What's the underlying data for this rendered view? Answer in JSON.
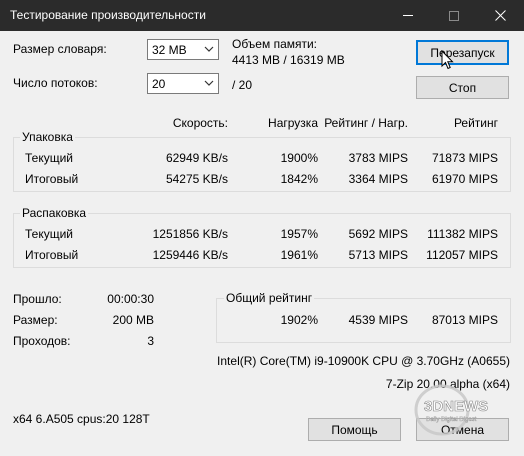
{
  "window": {
    "title": "Тестирование производительности"
  },
  "top": {
    "dict_label": "Размер словаря:",
    "dict_value": "32 MB",
    "threads_label": "Число потоков:",
    "threads_value": "20",
    "threads_max": "/ 20",
    "memory_label": "Объем памяти:",
    "memory_value": "4413 MB / 16319 MB",
    "restart_button": "Перезапуск",
    "stop_button": "Стоп"
  },
  "headers": {
    "speed": "Скорость:",
    "load": "Нагрузка",
    "rating_load": "Рейтинг / Нагр.",
    "rating": "Рейтинг"
  },
  "packing": {
    "title": "Упаковка",
    "rows": [
      {
        "name": "Текущий",
        "speed": "62949 KB/s",
        "load": "1900%",
        "rating_load": "3783 MIPS",
        "rating": "71873 MIPS"
      },
      {
        "name": "Итоговый",
        "speed": "54275 KB/s",
        "load": "1842%",
        "rating_load": "3364 MIPS",
        "rating": "61970 MIPS"
      }
    ]
  },
  "unpacking": {
    "title": "Распаковка",
    "rows": [
      {
        "name": "Текущий",
        "speed": "1251856 KB/s",
        "load": "1957%",
        "rating_load": "5692 MIPS",
        "rating": "111382 MIPS"
      },
      {
        "name": "Итоговый",
        "speed": "1259446 KB/s",
        "load": "1961%",
        "rating_load": "5713 MIPS",
        "rating": "112057 MIPS"
      }
    ]
  },
  "stats": {
    "elapsed_label": "Прошло:",
    "elapsed_value": "00:00:30",
    "size_label": "Размер:",
    "size_value": "200 MB",
    "passes_label": "Проходов:",
    "passes_value": "3"
  },
  "overall": {
    "title": "Общий рейтинг",
    "load": "1902%",
    "rating_load": "4539 MIPS",
    "rating": "87013 MIPS"
  },
  "cpu": "Intel(R) Core(TM) i9-10900K CPU @ 3.70GHz (A0655)",
  "version": "7-Zip 20.00 alpha (x64)",
  "sysinfo": "x64 6.A505 cpus:20 128T",
  "bottom": {
    "help_button": "Помощь",
    "cancel_button": "Отмена"
  },
  "watermark": {
    "logo": "3DNEWS",
    "tagline": "Daily Digital Digest"
  },
  "icons": {
    "minimize": "minimize-icon",
    "maximize": "maximize-icon",
    "close": "close-icon",
    "dropdown": "chevron-down-icon",
    "cursor": "mouse-cursor-icon"
  }
}
